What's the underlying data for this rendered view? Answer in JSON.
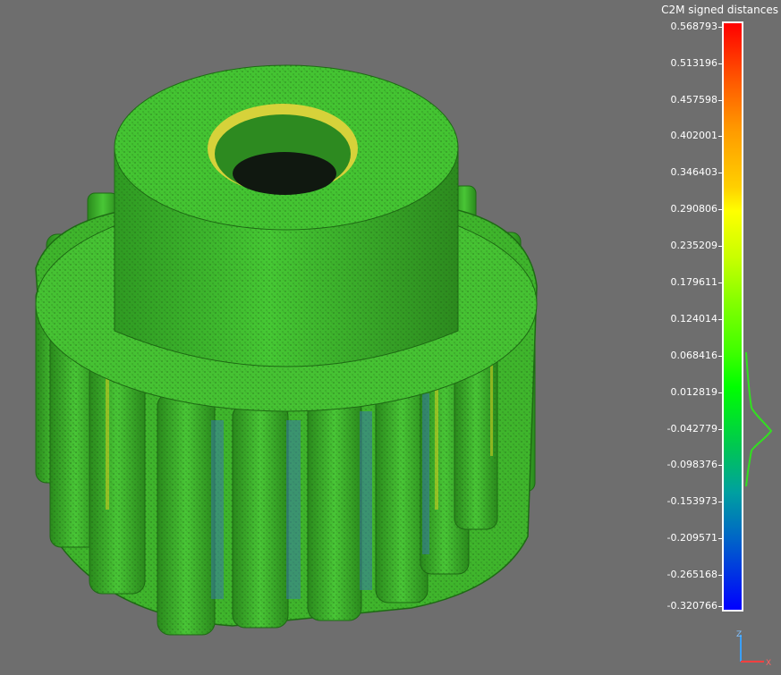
{
  "scalar_field": {
    "title": "C2M signed distances",
    "ticks": [
      "0.568793",
      "0.513196",
      "0.457598",
      "0.402001",
      "0.346403",
      "0.290806",
      "0.235209",
      "0.179611",
      "0.124014",
      "0.068416",
      "0.012819",
      "-0.042779",
      "-0.098376",
      "-0.153973",
      "-0.209571",
      "-0.265168",
      "-0.320766"
    ],
    "max": 0.568793,
    "min": -0.320766
  },
  "axes": {
    "z": "Z",
    "x": "X"
  },
  "colors": {
    "background": "#6e6e6e",
    "gear_green": "#3fbe2a",
    "gear_dark": "#2f8e1f",
    "gear_light": "#57d43e",
    "yellow_edge": "#d8d020",
    "blue_edge": "#3060b0"
  }
}
